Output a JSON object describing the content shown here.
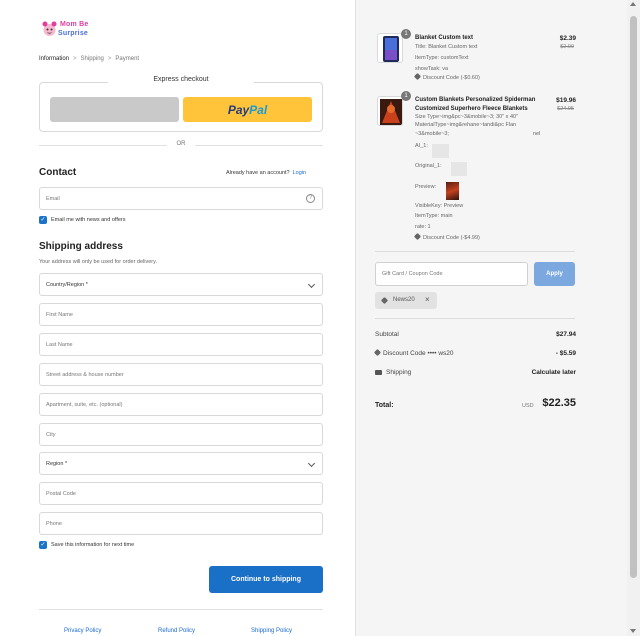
{
  "brand": {
    "line1": "Mom Be",
    "line2": "Surprise"
  },
  "breadcrumb": {
    "information": "Information",
    "shipping": "Shipping",
    "payment": "Payment",
    "sep": ">"
  },
  "express": {
    "label": "Express checkout",
    "paypal_a": "Pay",
    "paypal_b": "Pal",
    "or": "OR"
  },
  "contact": {
    "title": "Contact",
    "have_account": "Already have an account?",
    "login": "Login",
    "email_placeholder": "Email",
    "news_label": "Email me with news and offers"
  },
  "shipping": {
    "title": "Shipping address",
    "note": "Your address will only be used for order delivery.",
    "country": "Country/Region *",
    "first_name": "First Name",
    "last_name": "Last Name",
    "street": "Street address & house number",
    "apartment": "Apartment, suite, etc. (optional)",
    "city": "City",
    "region": "Region *",
    "postal": "Postal Code",
    "phone": "Phone",
    "save_label": "Save this information for next time",
    "continue": "Continue to shipping"
  },
  "footer": {
    "privacy": "Privacy Policy",
    "refund": "Refund Policy",
    "shipping": "Shipping Policy"
  },
  "cart": {
    "items": [
      {
        "qty": "1",
        "title": "Blanket Custom text",
        "lines": [
          "Title: Blanket Custom text",
          "ItemType: customText",
          "showTask: va"
        ],
        "discount": "Discount Code (-$0.60)",
        "price": "$2.39",
        "old_price": "$2.99"
      },
      {
        "qty": "1",
        "title_line1": "Custom Blankets Personalized Spiderman",
        "title_line2": "Customized Superhero Fleece Blankets",
        "lines": [
          "Size Type~img&pc~3&mobile~3; 30\" x 40\"",
          "MaterialType~img&rehane~tandi&pc Flan",
          "~3&mobile~3;",
          "AI_1:",
          "Original_1:",
          "Preview:",
          "VisibleKey: Preview",
          "ItemType: main",
          "rate: 1"
        ],
        "flan_suffix": "nel",
        "discount": "Discount Code (-$4.99)",
        "price": "$19.96",
        "old_price": "$24.95"
      }
    ],
    "coupon_placeholder": "Gift Card / Coupon Code",
    "apply": "Apply",
    "applied_code": "News20",
    "subtotal_label": "Subtotal",
    "subtotal_value": "$27.94",
    "discount_label": "Discount Code",
    "discount_code_masked": "•••• ws20",
    "discount_value": "- $5.59",
    "shipping_label": "Shipping",
    "shipping_value": "Calculate later",
    "total_label": "Total:",
    "currency": "USD",
    "total_value": "$22.35"
  }
}
